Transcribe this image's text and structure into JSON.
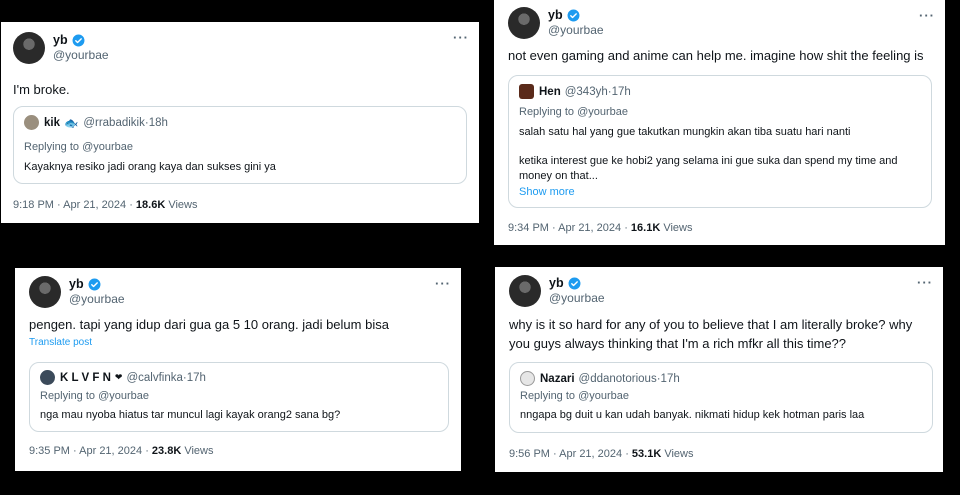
{
  "tweets": [
    {
      "user": {
        "name": "yb",
        "handle": "@yourbae"
      },
      "text": "I'm broke.",
      "quote": {
        "name": "kik",
        "emoji": "🐟",
        "handle": "@rrabadikik",
        "time": "18h",
        "replying": "Replying to @yourbae",
        "lines": [
          "Kayaknya resiko jadi orang kaya dan sukses gini ya"
        ]
      },
      "time": "9:18 PM",
      "date": "Apr 21, 2024",
      "views_count": "18.6K",
      "views_label": "Views"
    },
    {
      "user": {
        "name": "yb",
        "handle": "@yourbae"
      },
      "text": "not even gaming and anime can help me. imagine how shit the feeling is",
      "quote": {
        "name": "Hen",
        "handle": "@343yh",
        "time": "17h",
        "replying": "Replying to @yourbae",
        "lines": [
          "salah satu hal yang gue takutkan mungkin akan tiba suatu hari nanti",
          "ketika interest gue ke hobi2 yang selama ini gue suka dan spend my time and",
          "money on that..."
        ],
        "show_more": "Show more"
      },
      "time": "9:34 PM",
      "date": "Apr 21, 2024",
      "views_count": "16.1K",
      "views_label": "Views"
    },
    {
      "user": {
        "name": "yb",
        "handle": "@yourbae"
      },
      "text": "pengen. tapi yang idup dari gua ga 5 10 orang. jadi belum bisa",
      "translate": "Translate post",
      "quote": {
        "name": "K L V F N",
        "emoji": "❤",
        "handle": "@calvfinka",
        "time": "17h",
        "replying": "Replying to @yourbae",
        "lines": [
          "nga mau nyoba hiatus tar muncul lagi kayak orang2 sana bg?"
        ]
      },
      "time": "9:35 PM",
      "date": "Apr 21, 2024",
      "views_count": "23.8K",
      "views_label": "Views"
    },
    {
      "user": {
        "name": "yb",
        "handle": "@yourbae"
      },
      "text_lines": [
        "why is it so hard for any of you to believe that I am literally broke? why",
        "you guys always thinking that I'm a rich mfkr all this time??"
      ],
      "quote": {
        "name": "Nazari",
        "handle": "@ddanotorious",
        "time": "17h",
        "replying": "Replying to @yourbae",
        "lines": [
          "nngapa bg duit u kan udah banyak. nikmati hidup kek hotman paris laa"
        ]
      },
      "time": "9:56 PM",
      "date": "Apr 21, 2024",
      "views_count": "53.1K",
      "views_label": "Views"
    }
  ],
  "separator": " · ",
  "more_icon": "more-horizontal-icon",
  "colors": {
    "verified": "#1d9bf0",
    "secondary": "#536471",
    "link": "#1d9bf0"
  }
}
